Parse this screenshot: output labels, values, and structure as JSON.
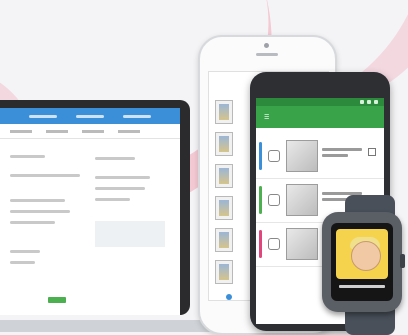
{
  "scene": {
    "laptop_header_color": "#3a8fd8",
    "android_toolbar_color": "#39a34a",
    "watch_background_color": "#f6d34d",
    "background_swoosh_color": "#f3a7b8"
  },
  "icons": [
    "bell-icon",
    "copy-icon",
    "grid-icon"
  ]
}
